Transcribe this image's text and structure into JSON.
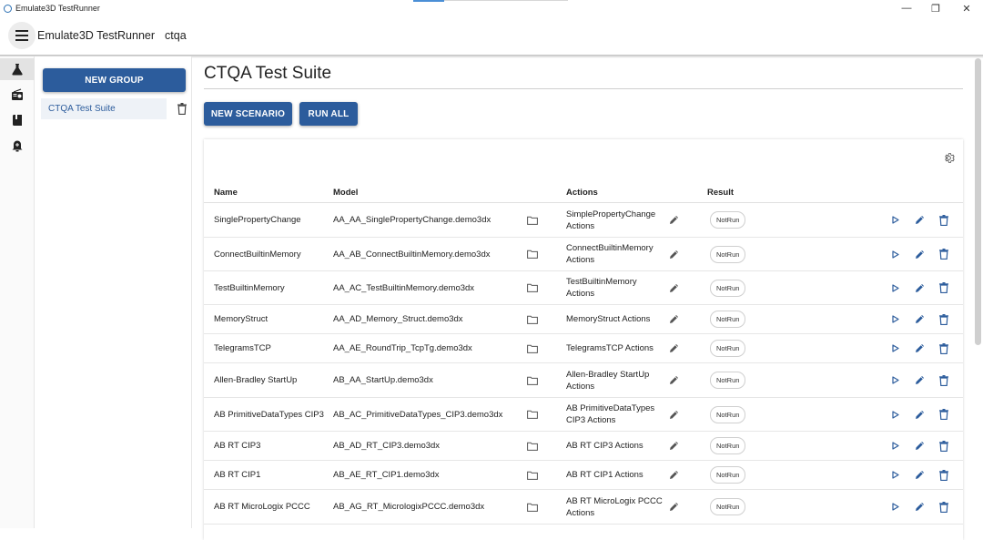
{
  "window": {
    "title": "Emulate3D TestRunner",
    "minimize": "—",
    "maximize": "❐",
    "close": "✕"
  },
  "appbar": {
    "title": "Emulate3D TestRunner",
    "project": "ctqa"
  },
  "groups": {
    "new_group_label": "NEW GROUP",
    "items": [
      {
        "label": "CTQA Test Suite"
      }
    ]
  },
  "main": {
    "title": "CTQA Test Suite",
    "new_scenario_label": "NEW SCENARIO",
    "run_all_label": "RUN ALL"
  },
  "table": {
    "headers": {
      "name": "Name",
      "model": "Model",
      "actions": "Actions",
      "result": "Result"
    },
    "rows": [
      {
        "name": "SinglePropertyChange",
        "model": "AA_AA_SinglePropertyChange.demo3dx",
        "actions": "SimplePropertyChange Actions",
        "result": "NotRun"
      },
      {
        "name": "ConnectBuiltinMemory",
        "model": "AA_AB_ConnectBuiltinMemory.demo3dx",
        "actions": "ConnectBuiltinMemory Actions",
        "result": "NotRun"
      },
      {
        "name": "TestBuiltinMemory",
        "model": "AA_AC_TestBuiltinMemory.demo3dx",
        "actions": "TestBuiltinMemory Actions",
        "result": "NotRun"
      },
      {
        "name": "MemoryStruct",
        "model": "AA_AD_Memory_Struct.demo3dx",
        "actions": "MemoryStruct Actions",
        "result": "NotRun"
      },
      {
        "name": "TelegramsTCP",
        "model": "AA_AE_RoundTrip_TcpTg.demo3dx",
        "actions": "TelegramsTCP Actions",
        "result": "NotRun"
      },
      {
        "name": "Allen-Bradley StartUp",
        "model": "AB_AA_StartUp.demo3dx",
        "actions": "Allen-Bradley StartUp Actions",
        "result": "NotRun"
      },
      {
        "name": "AB PrimitiveDataTypes CIP3",
        "model": "AB_AC_PrimitiveDataTypes_CIP3.demo3dx",
        "actions": "AB PrimitiveDataTypes CIP3 Actions",
        "result": "NotRun"
      },
      {
        "name": "AB RT CIP3",
        "model": "AB_AD_RT_CIP3.demo3dx",
        "actions": "AB RT CIP3 Actions",
        "result": "NotRun"
      },
      {
        "name": "AB RT CIP1",
        "model": "AB_AE_RT_CIP1.demo3dx",
        "actions": "AB RT CIP1 Actions",
        "result": "NotRun"
      },
      {
        "name": "AB RT MicroLogix PCCC",
        "model": "AB_AG_RT_MicrologixPCCC.demo3dx",
        "actions": "AB RT MicroLogix PCCC Actions",
        "result": "NotRun"
      }
    ]
  },
  "icons": {
    "rail": [
      "flask-icon",
      "radio-icon",
      "book-icon",
      "alarm-icon"
    ],
    "row": [
      "folder-icon",
      "pencil-icon",
      "play-icon",
      "edit-icon",
      "trash-icon"
    ],
    "settings": "gear-icon"
  },
  "colors": {
    "primary": "#2c5c9c",
    "selected_group_bg": "#eef2f7",
    "rail_active_bg": "#e3e3e3"
  }
}
